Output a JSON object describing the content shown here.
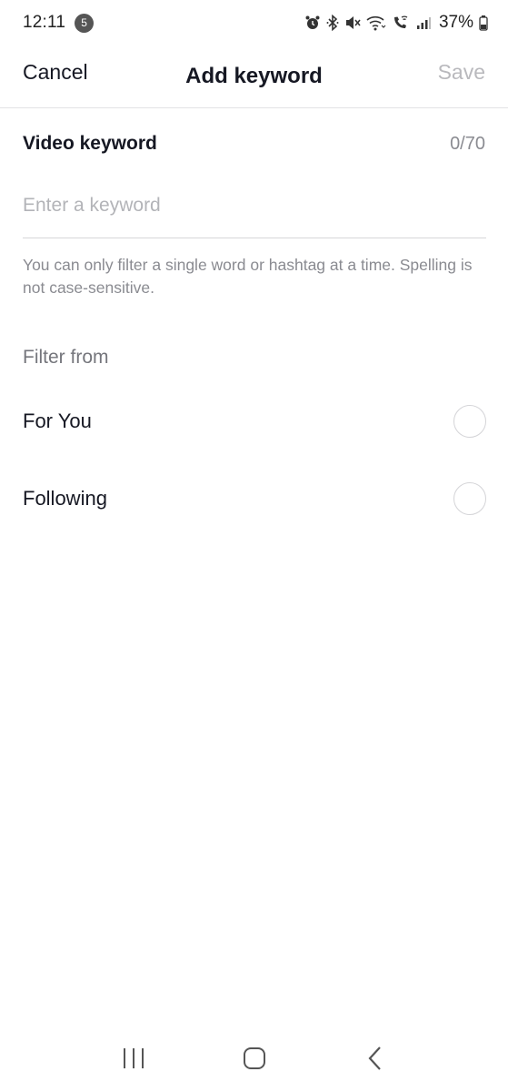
{
  "status_bar": {
    "time": "12:11",
    "notification_count": "5",
    "battery_percent": "37%",
    "icons": [
      "alarm-icon",
      "bluetooth-icon",
      "mute-icon",
      "wifi-icon",
      "wifi-calling-icon",
      "signal-icon",
      "battery-icon"
    ]
  },
  "header": {
    "cancel_label": "Cancel",
    "title": "Add keyword",
    "save_label": "Save"
  },
  "keyword": {
    "label": "Video keyword",
    "counter": "0/70",
    "placeholder": "Enter a keyword",
    "value": "",
    "hint": "You can only filter a single word or hashtag at a time. Spelling is not case-sensitive."
  },
  "filter": {
    "heading": "Filter from",
    "options": [
      {
        "label": "For You",
        "selected": false
      },
      {
        "label": "Following",
        "selected": false
      }
    ]
  },
  "nav": {
    "icons": [
      "recent-apps-icon",
      "home-icon",
      "back-icon"
    ]
  },
  "colors": {
    "text_primary": "#161823",
    "text_secondary": "#8a8b91",
    "save_disabled": "#b9b9bd",
    "divider": "#e3e3e5"
  }
}
